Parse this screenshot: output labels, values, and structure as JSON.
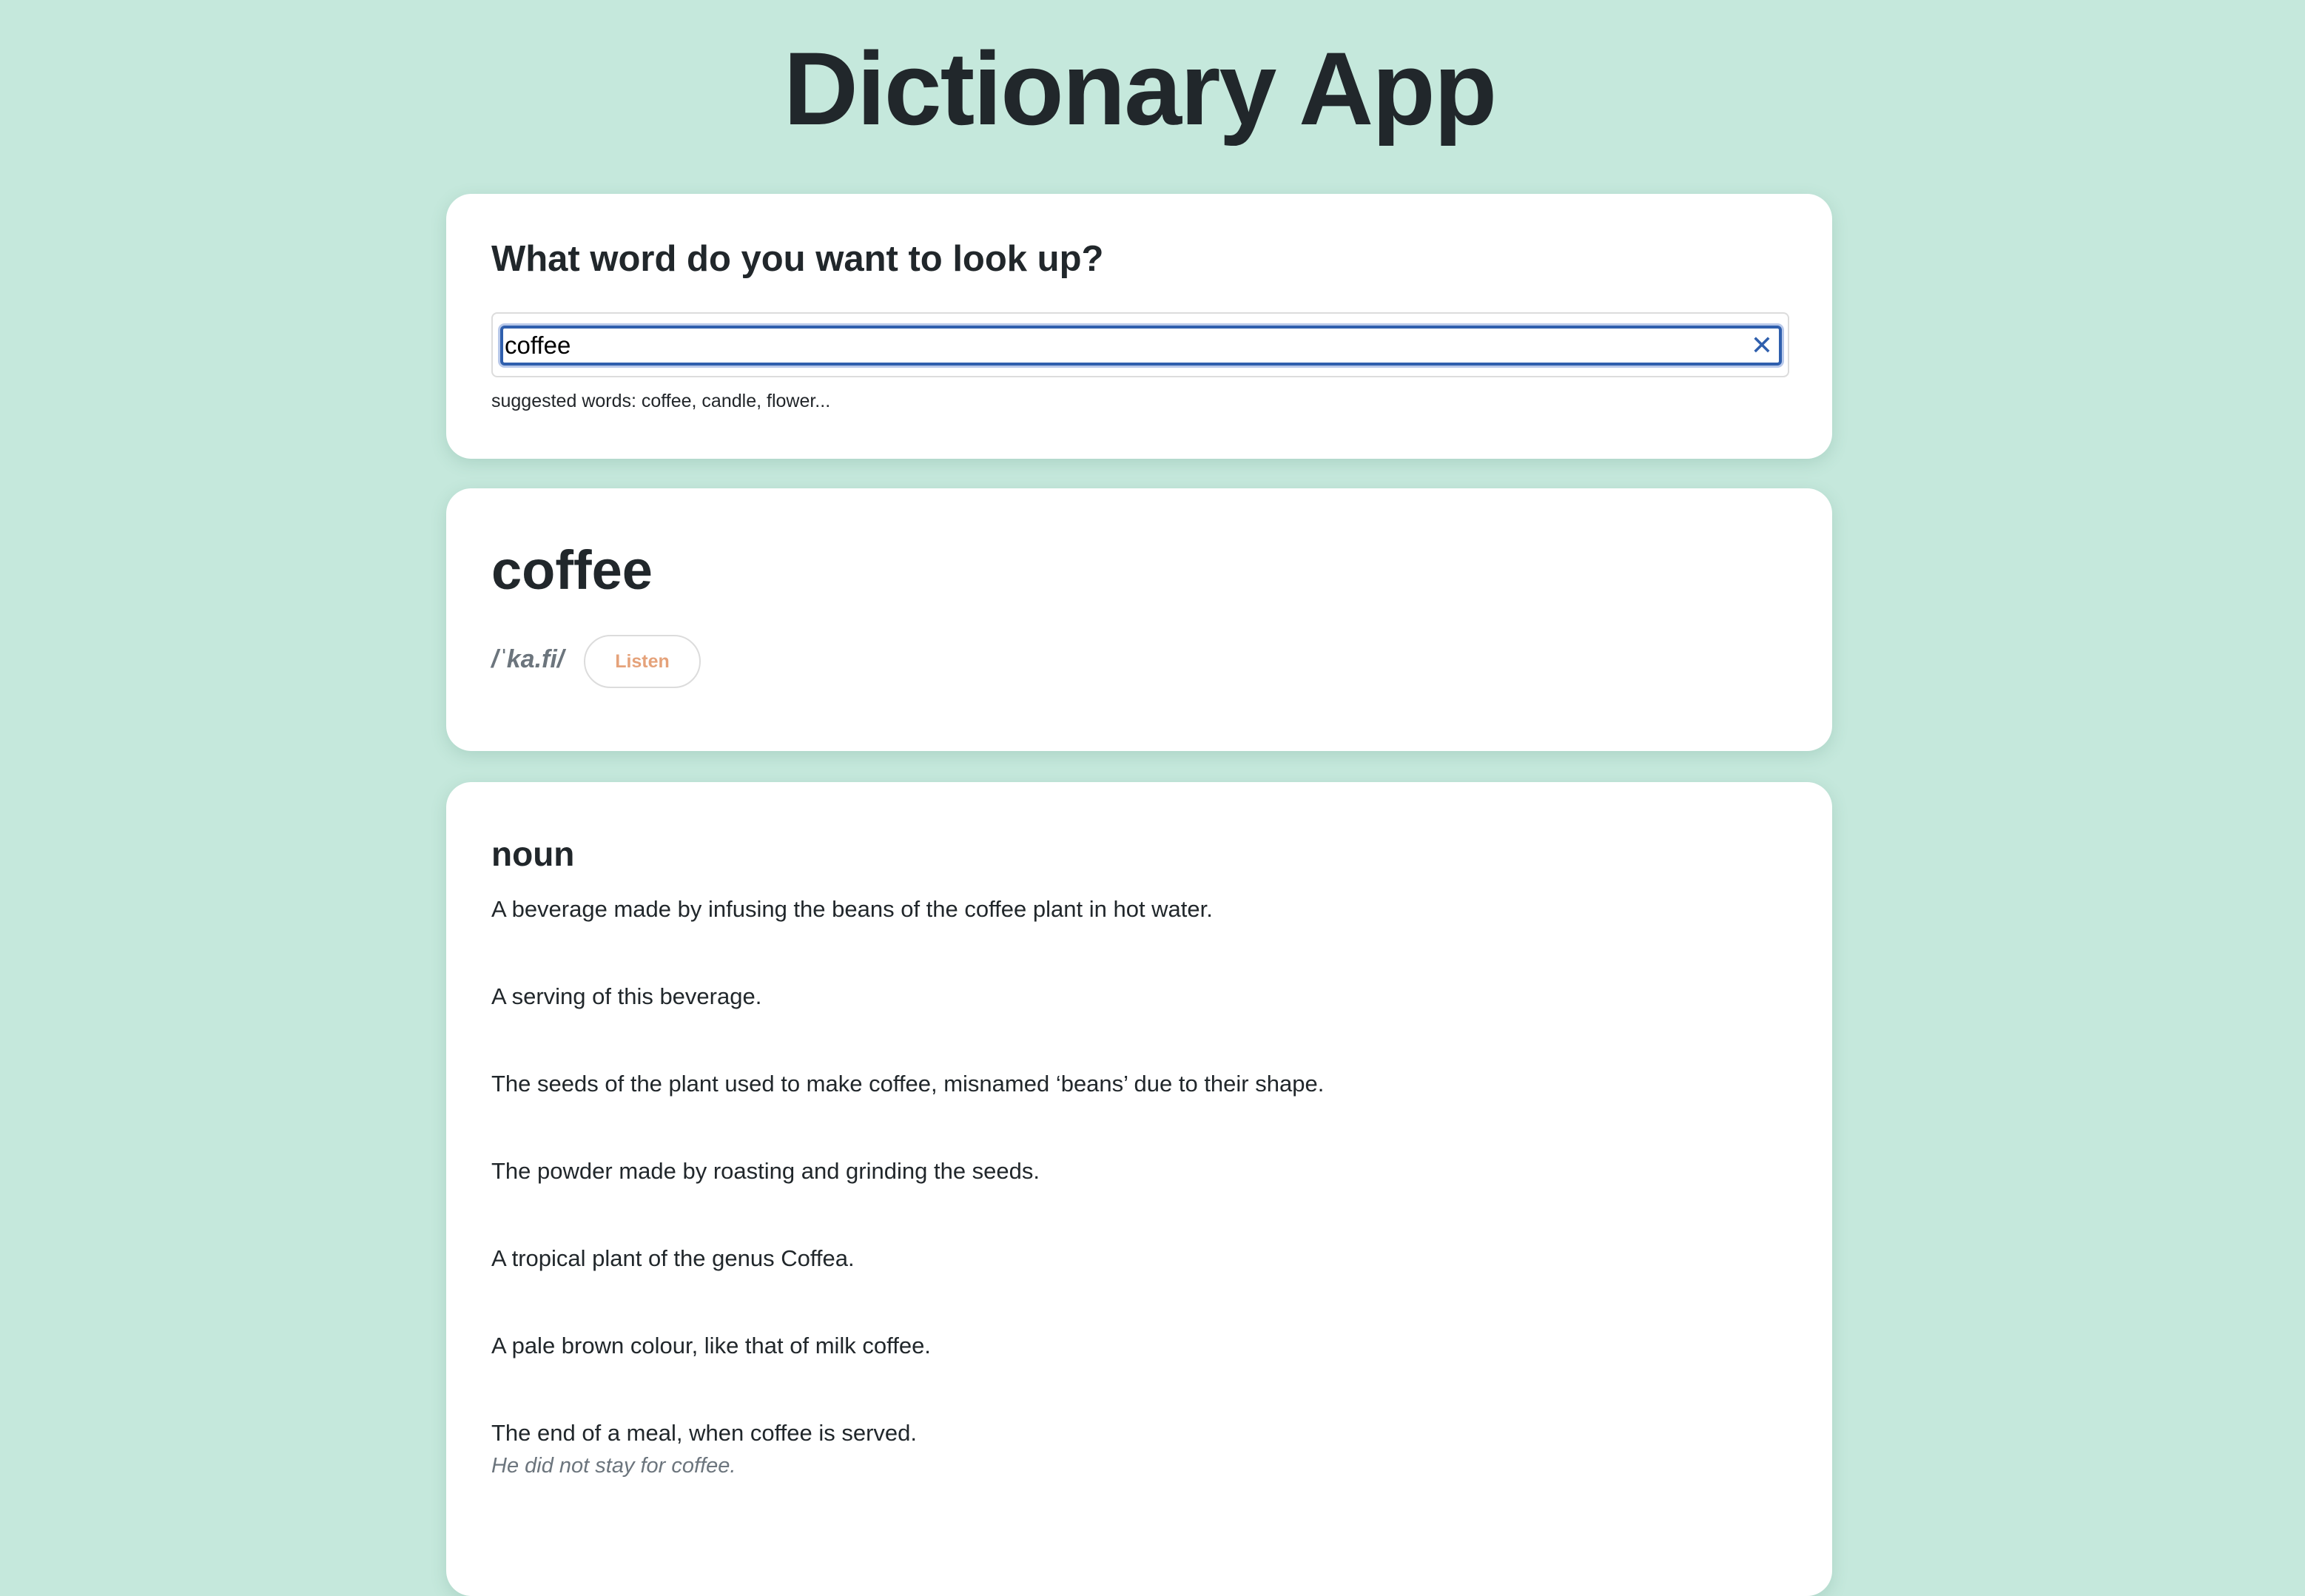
{
  "app": {
    "title": "Dictionary App"
  },
  "search": {
    "heading": "What word do you want to look up?",
    "value": "coffee",
    "clear_icon": "close-icon",
    "suggestions_text": "suggested words: coffee, candle, flower..."
  },
  "word": {
    "term": "coffee",
    "phonetic": "/ˈka.fi/",
    "listen_label": "Listen"
  },
  "meanings": [
    {
      "part_of_speech": "noun",
      "definitions": [
        {
          "text": "A beverage made by infusing the beans of the coffee plant in hot water.",
          "example": ""
        },
        {
          "text": "A serving of this beverage.",
          "example": ""
        },
        {
          "text": "The seeds of the plant used to make coffee, misnamed ‘beans’ due to their shape.",
          "example": ""
        },
        {
          "text": "The powder made by roasting and grinding the seeds.",
          "example": ""
        },
        {
          "text": "A tropical plant of the genus Coffea.",
          "example": ""
        },
        {
          "text": "A pale brown colour, like that of milk coffee.",
          "example": ""
        },
        {
          "text": "The end of a meal, when coffee is served.",
          "example": "He did not stay for coffee."
        }
      ]
    }
  ],
  "colors": {
    "background": "#c5e8dc",
    "card": "#ffffff",
    "accent_focus": "#2f5fad",
    "listen_text": "#e5a27a",
    "muted_text": "#6c757d"
  }
}
